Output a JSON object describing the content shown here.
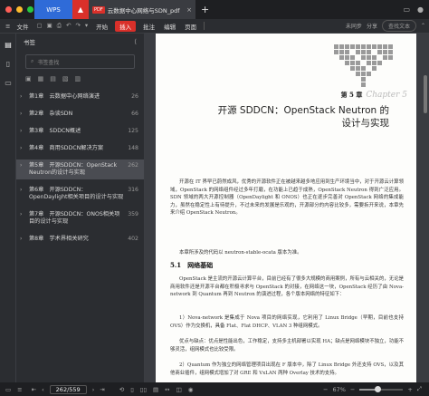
{
  "tabs": {
    "wps": "WPS",
    "doc_title": "云数据中心网络与SDN_pdf",
    "pdf_badge": "PDF",
    "close": "×",
    "new": "+"
  },
  "menu": {
    "file": "文件",
    "start": "开始",
    "insert": "插入",
    "annotate": "批注",
    "edit": "编辑",
    "page": "页面",
    "unsync": "未同步",
    "share": "分享",
    "search_placeholder": "查找文本"
  },
  "panel": {
    "title": "书签",
    "search_placeholder": "书签查找",
    "items": [
      {
        "label": "第1章　云数据中心网络演进",
        "page": "26",
        "arrow": "›"
      },
      {
        "label": "第2章　杂谈SDN",
        "page": "66",
        "arrow": "›"
      },
      {
        "label": "第3章　SDDCN概述",
        "page": "125",
        "arrow": "›"
      },
      {
        "label": "第4章　商用SDDCN解决方案",
        "page": "148",
        "arrow": "›"
      },
      {
        "label": "第5章　开源SDDCN：OpenStack Neutron的设计与实现",
        "page": "262",
        "arrow": "›"
      },
      {
        "label": "第6章　开源SDDCN：OpenDaylight相关项目的设计与实现",
        "page": "316",
        "arrow": "›"
      },
      {
        "label": "第7章　开源SDDCN：ONOS相关项目的设计与实现",
        "page": "359",
        "arrow": "›"
      },
      {
        "label": "第8章　学术界相关研究",
        "page": "402",
        "arrow": "›"
      }
    ],
    "selected_index": 4
  },
  "document": {
    "chapter_num": "第 5 章",
    "chapter_script": "Chapter 5",
    "title_line1": "开源 SDDCN：OpenStack Neutron 的",
    "title_line2": "设计与实现",
    "intro": "开源在 IT 界早已蔚然成风，优秀的开源软件正在被越来越多地应用到生产环境当中，对于开源云计算领域，OpenStack 的网络组件经过多年打磨，在功能上已趋于成熟，OpenStack Neutron 得到广泛应用。SDN 领域的两大开源控制器（OpenDaylight 和 ONOS）也正在逐步完善对 OpenStack 网络的集成能力，虽然在稳定性上有待提升，不过未来的发展是乐观的，开源部分的内容比较多，需要拆开来说，本章先来介绍 OpenStack Neutron。",
    "intro2": "本章所涉及的代码以 neutron-stable-ocata 版本为准。",
    "section": "5.1　网络基础",
    "p1": "OpenStack 是主流的开源云计算平台，目前已经有了很多大规模的商用案例，所有与云相关的，无论是商用软件还是开源平台都在积极寻求与 OpenStack 的对接，在网络这一块，OpenStack 经历了由 Nova-network 到 Quantum 再到 Neutron 的演进过程，各个版本网络的特征如下：",
    "p2": "1）Nova-network 是集成于 Nova 项目的网络实现，它利用了 Linux Bridge（早期，目前也支持 OVS）作为交换机，具备 Flat、Flat DHCP、VLAN 3 种组网模式。",
    "p3": "优点与缺点：优点是性能出色，工作稳定，支持多主机部署以实现 HA；缺点是网络模块不独立，功能不够灵活，组网模式也比较受限。",
    "p4": "2）Quantum 作为独立的网络管理项目出现在 F 版本中，除了 Linux Bridge 外还支持 OVS，以及其他商业插件，组网模式增加了对 GRE 和 VxLAN 两种 Overlay 技术的支持。"
  },
  "status": {
    "page_display": "262/559",
    "zoom": "67%",
    "zoom_fraction": 0.67
  },
  "colors": {
    "accent": "#d9302a",
    "wps_blue": "#2f6bd8"
  }
}
